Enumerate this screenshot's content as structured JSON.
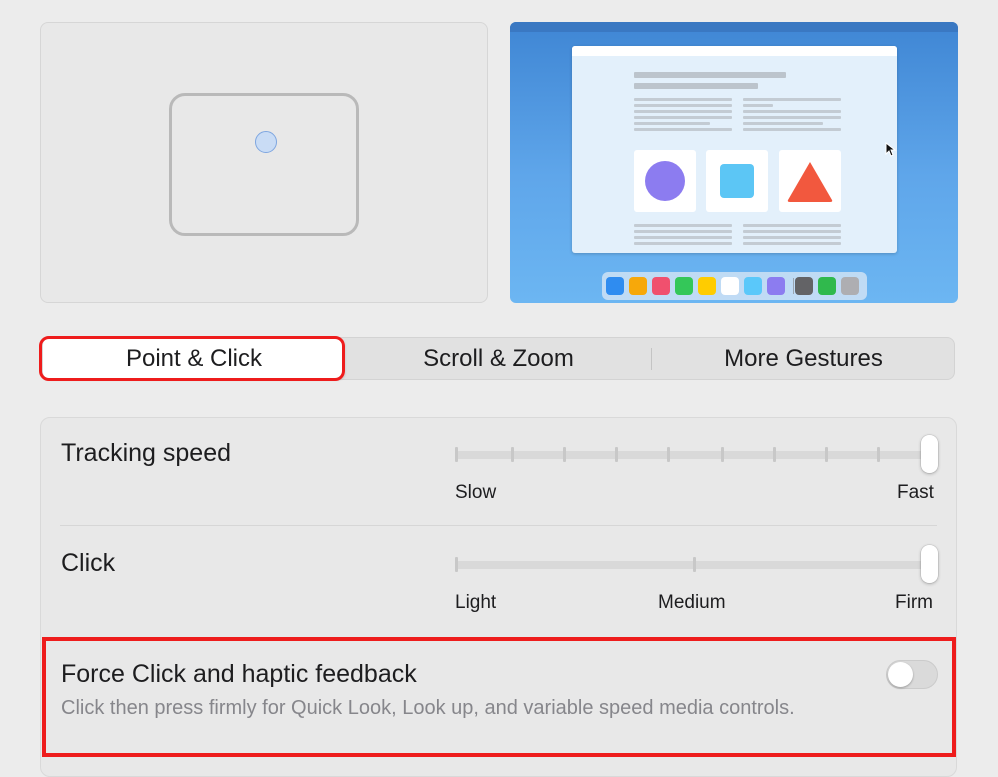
{
  "tabs": [
    {
      "label": "Point & Click",
      "selected": true
    },
    {
      "label": "Scroll & Zoom",
      "selected": false
    },
    {
      "label": "More Gestures",
      "selected": false
    }
  ],
  "tracking_speed": {
    "label": "Tracking speed",
    "min_label": "Slow",
    "max_label": "Fast",
    "tick_count": 10,
    "value": 1.0
  },
  "click": {
    "label": "Click",
    "min_label": "Light",
    "mid_label": "Medium",
    "max_label": "Firm",
    "value": 1.0
  },
  "force_click": {
    "label": "Force Click and haptic feedback",
    "description": "Click then press firmly for Quick Look, Look up, and variable speed media controls.",
    "enabled": false
  },
  "preview": {
    "trackpad_icon": "trackpad-icon",
    "dock_app_colors": [
      "#2f8cf0",
      "#f7a80a",
      "#f0506e",
      "#34c759",
      "#ffcc00",
      "#ffffff",
      "#5ac8fa",
      "#8c7cf0",
      "#636366",
      "#30b94d",
      "#aeaeb2"
    ]
  },
  "colors": {
    "highlight": "#ee1c1c",
    "window_bg": "#ececec"
  }
}
